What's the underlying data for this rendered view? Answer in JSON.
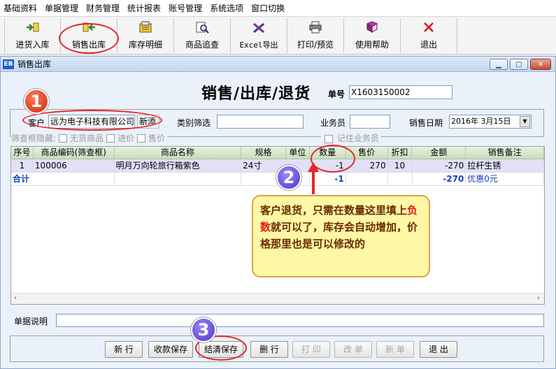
{
  "menubar": [
    "基础资料",
    "单据管理",
    "财务管理",
    "统计报表",
    "账号管理",
    "系统选项",
    "窗口切换"
  ],
  "toolbar": [
    {
      "label": "进货入库",
      "icon": "import-arrow-icon"
    },
    {
      "label": "销售出库",
      "icon": "export-arrow-icon"
    },
    {
      "label": "库存明细",
      "icon": "inventory-icon"
    },
    {
      "label": "商品追查",
      "icon": "magnifier-icon"
    },
    {
      "label": "Excel导出",
      "icon": "excel-icon"
    },
    {
      "label": "打印/预览",
      "icon": "printer-icon"
    },
    {
      "label": "使用帮助",
      "icon": "help-book-icon"
    },
    {
      "label": "退出",
      "icon": "exit-x-icon"
    }
  ],
  "window": {
    "icon_text": "EB",
    "title": "销售出库"
  },
  "form": {
    "title": "销售/出库/退货",
    "docno_label": "单号",
    "docno_value": "X1603150002",
    "customer_label": "客户",
    "customer_value": "远为电子科技有限公司",
    "new_button": "新添",
    "category_label": "类别筛选",
    "category_value": "",
    "salesman_label": "业务员",
    "salesman_value": "",
    "date_label": "销售日期",
    "date_value": "2016年 3月15日",
    "hide_label": "筛查框隐藏:",
    "opt_no_stock": "无货商品",
    "opt_purchase_price": "进价",
    "opt_sale_price": "售价",
    "opt_remember_salesman": "记住业务员"
  },
  "grid": {
    "headers": [
      "序号",
      "商品编码(筛查框)",
      "商品名称",
      "规格",
      "单位",
      "数量",
      "售价",
      "折扣",
      "金额",
      "销售备注"
    ],
    "rows": [
      {
        "no": "1",
        "code": "100006",
        "name": "明月万向轮旅行箱紫色",
        "spec": "24寸",
        "unit": "",
        "qty": "-1",
        "price": "270",
        "discount": "10",
        "amount": "-270",
        "remark": "拉杆生锈"
      }
    ],
    "total": {
      "label": "合计",
      "qty": "-1",
      "amount": "-270",
      "remark": "优惠0元"
    }
  },
  "memo_label": "单据说明",
  "memo_value": "",
  "actions": [
    {
      "label": "新 行",
      "enabled": true
    },
    {
      "label": "收款保存",
      "enabled": true
    },
    {
      "label": "结清保存",
      "enabled": true
    },
    {
      "label": "删 行",
      "enabled": true
    },
    {
      "label": "打 印",
      "enabled": false
    },
    {
      "label": "改 单",
      "enabled": false
    },
    {
      "label": "新 单",
      "enabled": false
    },
    {
      "label": "退 出",
      "enabled": true
    }
  ],
  "annotations": {
    "badge1": "1",
    "badge2": "2",
    "badge3": "3",
    "callout_part1": "客户退货，只需在数量这里填上",
    "callout_highlight": "负数",
    "callout_part2": "就可以了，库存会自动增加，价格那里也是可以修改的",
    "accent_red": "#e3272b",
    "callout_bg": "#fdf7a6"
  }
}
